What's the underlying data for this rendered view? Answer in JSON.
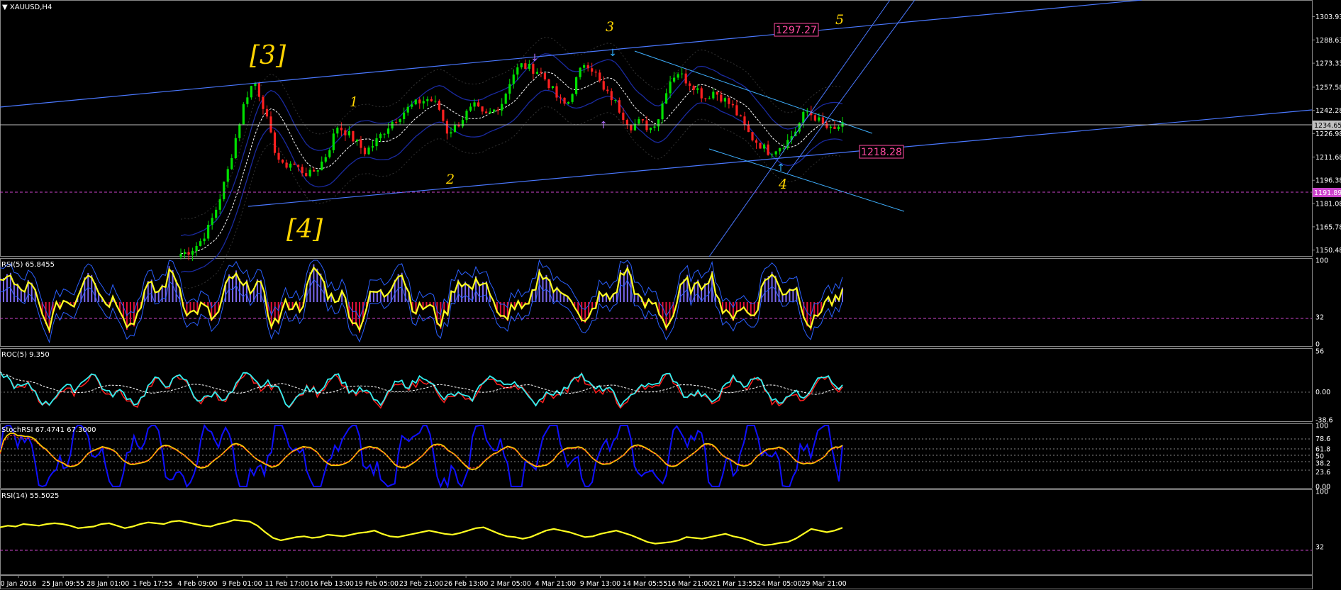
{
  "chart_data": [
    {
      "panel": "price",
      "type": "candlestick",
      "title": "XAUUSD,H4",
      "yticks": [
        "1303.93",
        "1288.63",
        "1273.33",
        "1257.58",
        "1242.28",
        "1226.98",
        "1211.68",
        "1196.38",
        "1181.08",
        "1165.78",
        "1150.48"
      ],
      "ylim": [
        1148,
        1313
      ],
      "current_price": "1234.65",
      "current_value": 1234.65,
      "dashed_level": "1191.89",
      "dashed_level_value": 1191.89,
      "markers": [
        {
          "label": "1297.27",
          "value": 1297.27
        },
        {
          "label": "1218.28",
          "value": 1218.28
        }
      ],
      "wave_labels": [
        "[3]",
        "[4]",
        "1",
        "2",
        "3",
        "4",
        "5"
      ],
      "close_path": [
        1148,
        1150,
        1155,
        1165,
        1180,
        1200,
        1225,
        1250,
        1262,
        1245,
        1220,
        1205,
        1208,
        1203,
        1200,
        1205,
        1215,
        1232,
        1228,
        1222,
        1215,
        1220,
        1228,
        1235,
        1240,
        1245,
        1248,
        1250,
        1245,
        1228,
        1232,
        1240,
        1245,
        1238,
        1242,
        1248,
        1265,
        1272,
        1270,
        1268,
        1260,
        1250,
        1245,
        1262,
        1275,
        1268,
        1255,
        1250,
        1240,
        1232,
        1235,
        1230,
        1238,
        1260,
        1268,
        1262,
        1258,
        1250,
        1255,
        1250,
        1245,
        1235,
        1225,
        1220,
        1215,
        1218,
        1222,
        1230,
        1242,
        1238,
        1232,
        1228,
        1234.65
      ],
      "bollinger_width": 12,
      "grid": false,
      "legend": "none"
    },
    {
      "panel": "rsi5",
      "type": "line",
      "title": "RSI(5) 65.8455",
      "yticks": [
        "100",
        "32",
        "0"
      ],
      "ylim": [
        0,
        100
      ],
      "level": 32,
      "last_value": 65.8455
    },
    {
      "panel": "roc5",
      "type": "line",
      "title": "ROC(5) 9.350",
      "yticks": [
        "56",
        "0.00",
        "-38.6"
      ],
      "ylim": [
        -38.6,
        56
      ],
      "last_value": 9.35
    },
    {
      "panel": "stochrsi",
      "type": "line",
      "title": "StochRSI 67.4741 67.3000",
      "yticks": [
        "100",
        "78.6",
        "61.8",
        "50",
        "38.2",
        "23.6",
        "0.00"
      ],
      "ylim": [
        0,
        100
      ],
      "levels": [
        100,
        78.6,
        61.8,
        50,
        38.2,
        23.6,
        0
      ],
      "last_value": 67.4741
    },
    {
      "panel": "rsi14",
      "type": "line",
      "title": "RSI(14) 55.5025",
      "yticks": [
        "100",
        "32"
      ],
      "ylim": [
        0,
        100
      ],
      "level": 32,
      "last_value": 55.5025,
      "values": [
        56,
        58,
        57,
        60,
        59,
        58,
        60,
        61,
        60,
        58,
        55,
        56,
        57,
        60,
        61,
        58,
        55,
        57,
        60,
        62,
        61,
        60,
        63,
        64,
        62,
        60,
        58,
        57,
        60,
        62,
        65,
        64,
        63,
        58,
        50,
        43,
        40,
        42,
        44,
        45,
        43,
        44,
        47,
        46,
        45,
        47,
        49,
        50,
        52,
        48,
        45,
        44,
        46,
        48,
        50,
        52,
        50,
        48,
        47,
        49,
        52,
        55,
        56,
        52,
        48,
        45,
        44,
        42,
        44,
        48,
        52,
        54,
        52,
        50,
        47,
        44,
        45,
        48,
        50,
        52,
        49,
        46,
        42,
        38,
        36,
        37,
        38,
        40,
        44,
        43,
        42,
        44,
        46,
        48,
        45,
        43,
        40,
        36,
        34,
        35,
        37,
        38,
        42,
        48,
        54,
        52,
        50,
        52,
        55.5025
      ]
    }
  ],
  "x_axis": {
    "labels": [
      "0 Jan 2016",
      "25 Jan 09:55",
      "28 Jan 01:00",
      "1 Feb 17:55",
      "4 Feb 09:00",
      "9 Feb 01:00",
      "11 Feb 17:00",
      "16 Feb 13:00",
      "19 Feb 05:00",
      "23 Feb 21:00",
      "26 Feb 13:00",
      "2 Mar 05:00",
      "4 Mar 21:00",
      "9 Mar 13:00",
      "14 Mar 05:55",
      "16 Mar 21:00",
      "21 Mar 13:55",
      "24 Mar 05:00",
      "29 Mar 21:00"
    ]
  },
  "colors": {
    "background": "#000000",
    "bull": "#00e000",
    "bear": "#ff2020",
    "trendline": "#4a78ff",
    "channel": "#3fb0ff",
    "bollinger": "#1a2aa0",
    "ma_dash": "#ffffff",
    "wave_label": "#ffd400",
    "marker": "#ff4aa0",
    "rsi_line": "#ffff20",
    "rsi_hist_pos": "#7b68ee",
    "rsi_hist_neg": "#e0103a",
    "roc_cyan": "#30f0f0",
    "roc_red": "#ff2020",
    "stoch_blue": "#1010ff",
    "stoch_yellow": "#ffcc00",
    "level_dash": "#cc44cc"
  }
}
